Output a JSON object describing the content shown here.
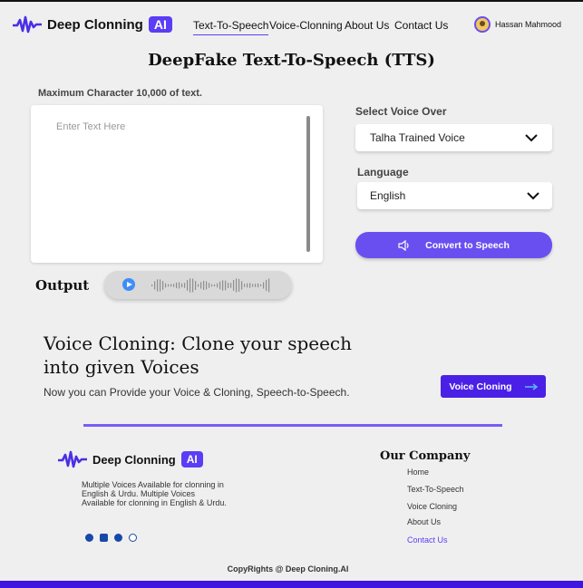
{
  "header": {
    "brand": "Deep Clonning",
    "badge": "AI",
    "nav": [
      "Text-To-Speech",
      "Voice-Clonning",
      "About Us",
      "Contact Us"
    ],
    "user_name": "Hassan Mahmood"
  },
  "main": {
    "title": "DeepFake Text-To-Speech (TTS)",
    "char_limit": "Maximum Character 10,000 of text.",
    "text_placeholder": "Enter Text Here",
    "output_label": "Output",
    "voice_label": "Select Voice Over",
    "voice_value": "Talha Trained Voice",
    "language_label": "Language",
    "language_value": "English",
    "convert_label": "Convert to Speech"
  },
  "promo": {
    "title_line1": "Voice Cloning: Clone your speech",
    "title_line2": "into given Voices",
    "subtitle": "Now you can Provide your Voice  & Cloning, Speech-to-Speech.",
    "button_label": "Voice Cloning"
  },
  "footer": {
    "brand": "Deep Clonning",
    "badge": "AI",
    "description": "Multiple Voices Available for clonning in English & Urdu. Multiple Voices Available for clonning in English & Urdu.",
    "company_title": "Our Company",
    "links": [
      "Home",
      "Text-To-Speech",
      "Voice Cloning",
      "About Us",
      "Contact Us"
    ],
    "copyright": "CopyRights @ Deep Cloning.AI"
  },
  "colors": {
    "accent": "#5b3df5",
    "button": "#6a4ff0",
    "bottom_bar": "#3f17e0"
  }
}
